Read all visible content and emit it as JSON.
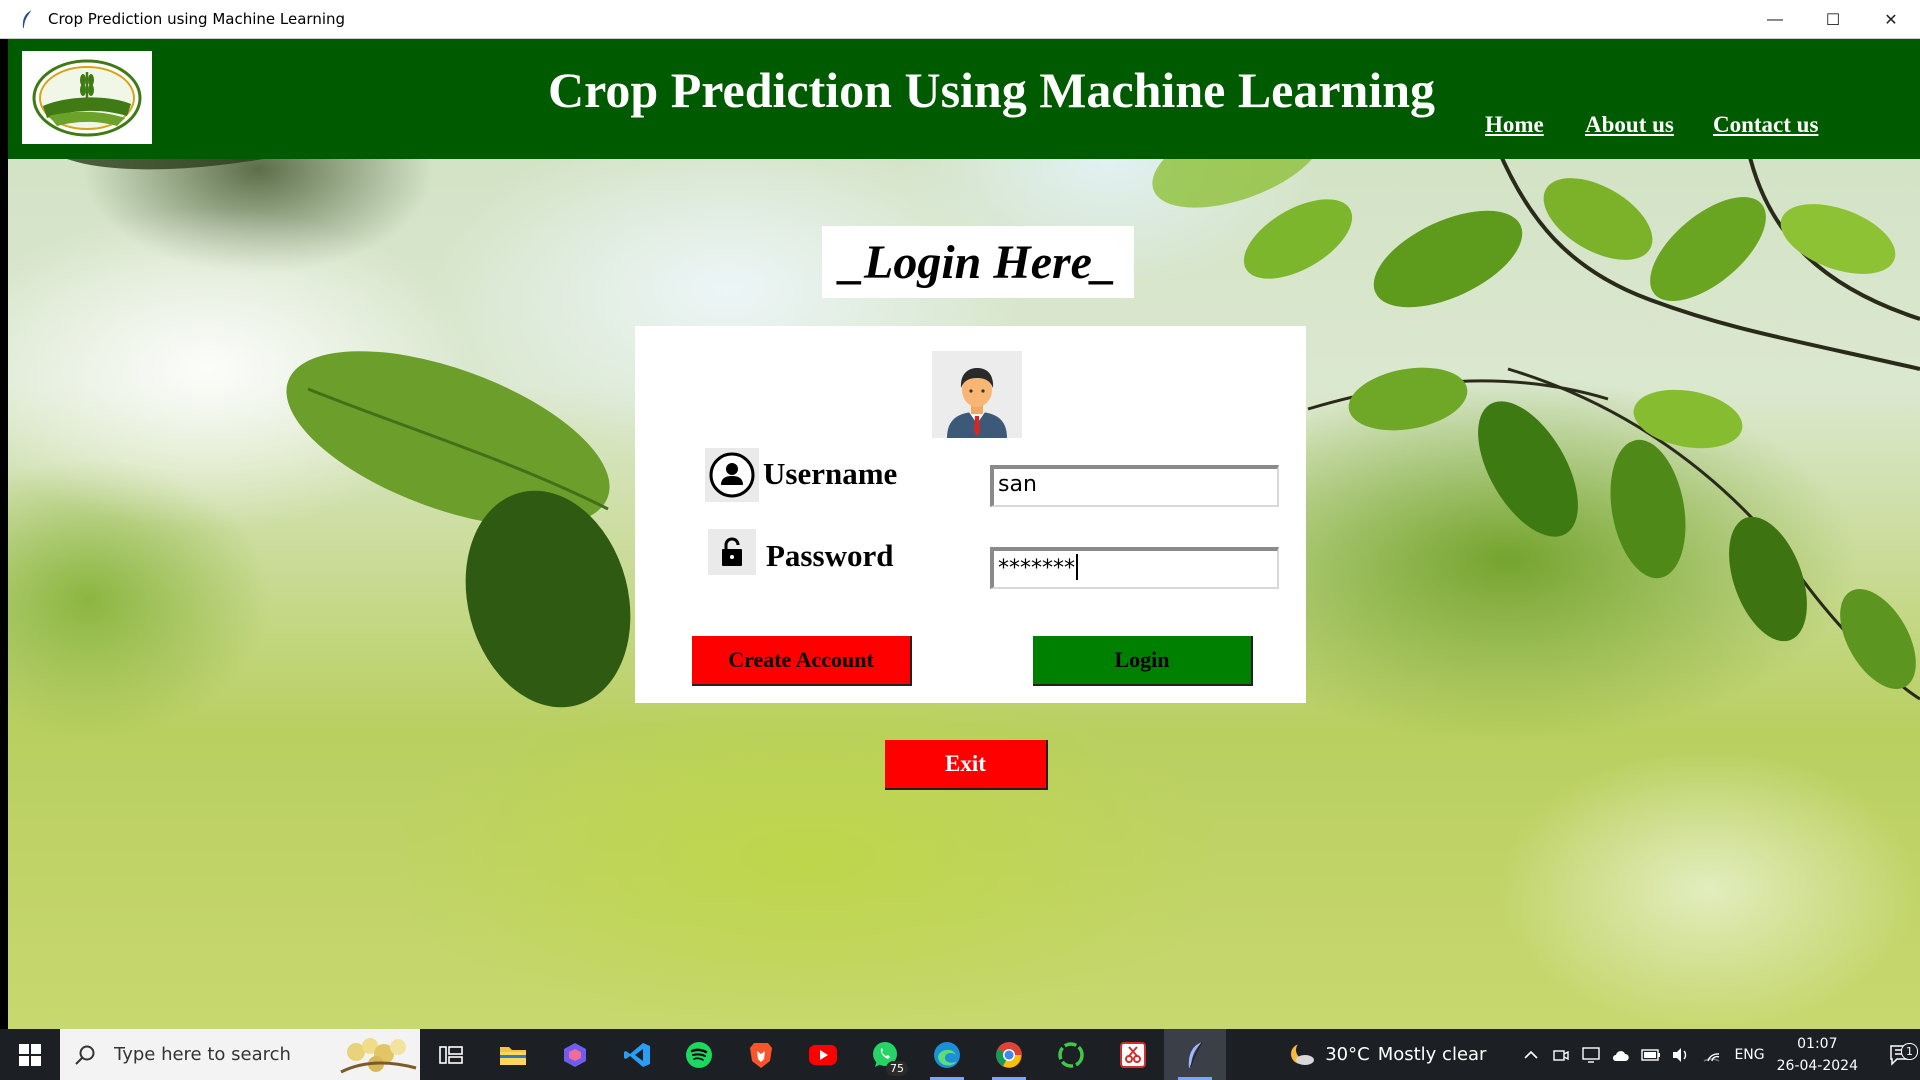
{
  "window": {
    "title": "Crop Prediction using Machine Learning",
    "controls": {
      "minimize": "—",
      "maximize": "☐",
      "close": "✕"
    }
  },
  "header": {
    "app_title": "Crop Prediction Using Machine Learning",
    "nav": {
      "home": "Home",
      "about": "About us",
      "contact": "Contact us"
    },
    "background_color": "#005b00"
  },
  "login": {
    "heading": "_Login Here_",
    "username_label": "Username",
    "password_label": "Password",
    "username_value": "san",
    "password_value": "*******",
    "create_account_label": "Create Account",
    "login_label": "Login",
    "exit_label": "Exit",
    "colors": {
      "create_account": "#ff0000",
      "login": "#008000",
      "exit": "#ff0000"
    }
  },
  "taskbar": {
    "search_placeholder": "Type here to search",
    "apps": [
      {
        "name": "task-view-icon"
      },
      {
        "name": "file-explorer-icon"
      },
      {
        "name": "copilot-icon"
      },
      {
        "name": "vscode-icon"
      },
      {
        "name": "spotify-icon"
      },
      {
        "name": "brave-icon"
      },
      {
        "name": "youtube-icon"
      },
      {
        "name": "whatsapp-icon",
        "badge": "75"
      },
      {
        "name": "edge-icon"
      },
      {
        "name": "chrome-icon"
      },
      {
        "name": "app-ring-icon"
      },
      {
        "name": "snipping-tool-icon"
      },
      {
        "name": "python-feather-icon"
      }
    ],
    "weather": {
      "temp": "30°C",
      "condition": "Mostly clear"
    },
    "language": "ENG",
    "time": "01:07",
    "date": "26-04-2024",
    "notification_count": "1"
  }
}
